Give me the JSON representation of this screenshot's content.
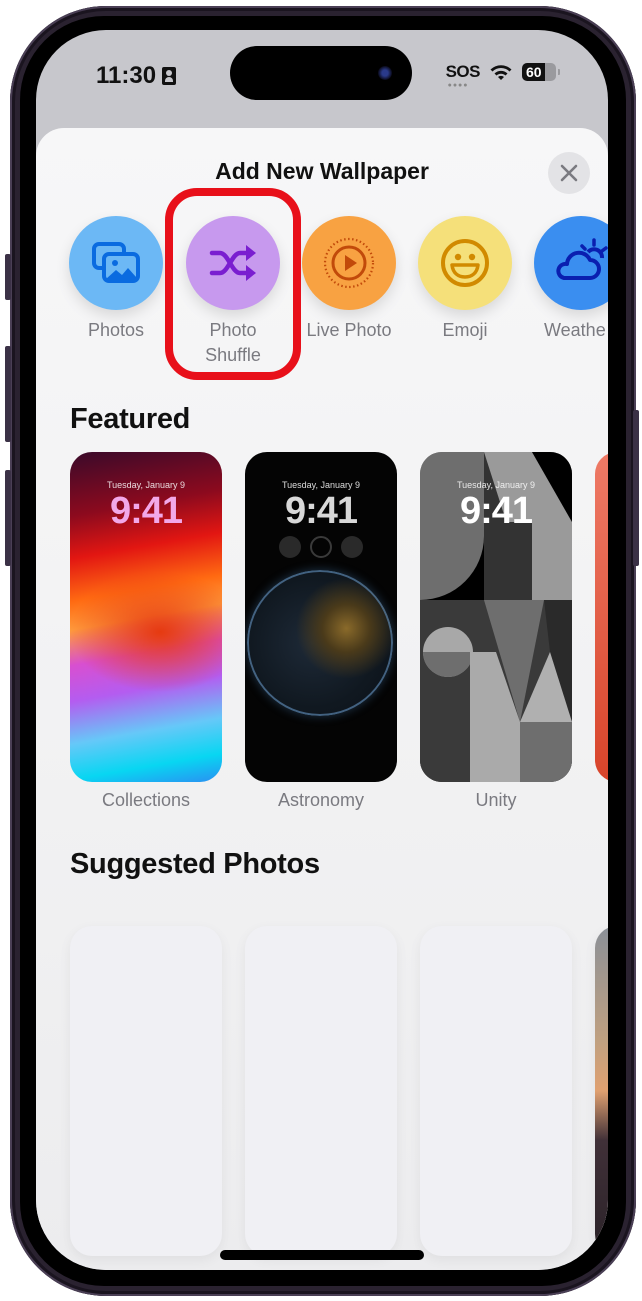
{
  "status_bar": {
    "time": "11:30",
    "carrier": "SOS",
    "battery_level": "60",
    "icons": [
      "focus-person-icon",
      "wifi-icon",
      "battery-icon"
    ]
  },
  "sheet": {
    "title": "Add New Wallpaper",
    "close_icon": "close-icon"
  },
  "wallpaper_types": [
    {
      "label": "Photos",
      "icon": "photos-icon",
      "color": "#6cb8f5"
    },
    {
      "label": "Photo\nShuffle",
      "line1": "Photo",
      "line2": "Shuffle",
      "icon": "shuffle-icon",
      "color": "#c799ee",
      "highlighted": true
    },
    {
      "label": "Live Photo",
      "icon": "live-photo-icon",
      "color": "#f8a242"
    },
    {
      "label": "Emoji",
      "icon": "emoji-icon",
      "color": "#f5e07a"
    },
    {
      "label": "Weather",
      "visible_text": "Weathe",
      "icon": "weather-icon",
      "color": "#3a8ef0"
    }
  ],
  "featured": {
    "title": "Featured",
    "cards": [
      {
        "label": "Collections",
        "date": "Tuesday, January 9",
        "time": "9:41"
      },
      {
        "label": "Astronomy",
        "date": "Tuesday, January 9",
        "time": "9:41"
      },
      {
        "label": "Unity",
        "date": "Tuesday, January 9",
        "time": "9:41"
      }
    ]
  },
  "suggested": {
    "title": "Suggested Photos"
  },
  "highlight_color": "#e8101a"
}
